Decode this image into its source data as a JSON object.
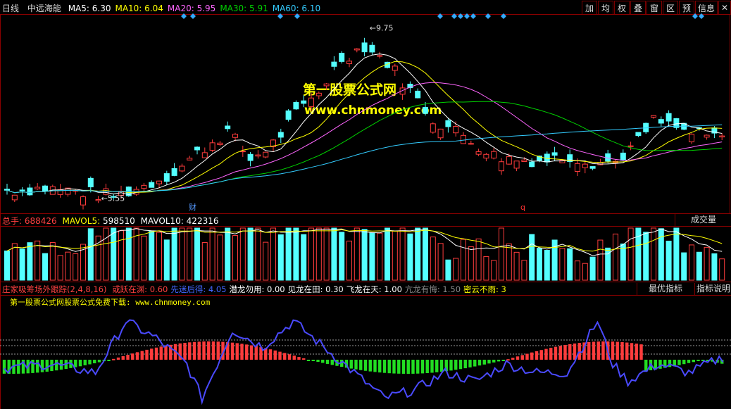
{
  "header": {
    "period": "日线",
    "stock_name": "中远海能",
    "ma": [
      {
        "label": "MA5:",
        "value": "6.30",
        "color": "#ffffff"
      },
      {
        "label": "MA10:",
        "value": "6.04",
        "color": "#ffff00"
      },
      {
        "label": "MA20:",
        "value": "5.95",
        "color": "#ff66ff"
      },
      {
        "label": "MA30:",
        "value": "5.91",
        "color": "#00d000"
      },
      {
        "label": "MA60:",
        "value": "6.10",
        "color": "#33ccff"
      }
    ]
  },
  "toolbar": [
    "加",
    "均",
    "权",
    "叠",
    "窗",
    "区",
    "预",
    "信息"
  ],
  "toolbar_close": "✕",
  "watermark": {
    "line1": "第一股票公式网",
    "line2": "www.chnmoney.com"
  },
  "price_markers": {
    "high": "9.75",
    "low": "5.55",
    "cai": "财",
    "q": "q"
  },
  "volume": {
    "total_label": "总手:",
    "total_value": "688426",
    "mavol5_label": "MAVOL5:",
    "mavol5_value": "598510",
    "mavol10_label": "MAVOL10:",
    "mavol10_value": "422316",
    "panel_button": "成交量"
  },
  "indicator": {
    "name": "庄家吸筹场外跟踪(2,4,8,16)",
    "items": [
      {
        "label": "或跃在渊:",
        "value": "0.60"
      },
      {
        "label": "先迷后得:",
        "value": "4.05"
      },
      {
        "label": "潜龙勿用:",
        "value": "0.00"
      },
      {
        "label": "见龙在田:",
        "value": "0.30"
      },
      {
        "label": "飞龙在天:",
        "value": "1.00"
      },
      {
        "label": "亢龙有悔:",
        "value": "1.50"
      },
      {
        "label": "密云不雨:",
        "value": "3"
      }
    ],
    "subtitle": "第一股票公式网股票公式免费下载: www.chnmoney.com",
    "btn_best": "最优指标",
    "btn_help": "指标说明"
  },
  "chart_data": [
    {
      "type": "candlestick",
      "title": "中远海能 日线",
      "ylim": [
        5.3,
        10.0
      ],
      "annotations": [
        {
          "text": "9.75",
          "type": "high"
        },
        {
          "text": "5.55",
          "type": "low"
        }
      ],
      "n": 95,
      "close_path": [
        [
          0,
          5.75
        ],
        [
          5,
          5.8
        ],
        [
          10,
          5.7
        ],
        [
          14,
          5.6
        ],
        [
          18,
          5.85
        ],
        [
          22,
          6.2
        ],
        [
          26,
          6.8
        ],
        [
          29,
          7.2
        ],
        [
          32,
          6.5
        ],
        [
          35,
          6.9
        ],
        [
          38,
          7.6
        ],
        [
          41,
          8.2
        ],
        [
          44,
          9.0
        ],
        [
          47,
          9.3
        ],
        [
          50,
          8.9
        ],
        [
          53,
          8.2
        ],
        [
          56,
          7.5
        ],
        [
          60,
          7.1
        ],
        [
          64,
          6.6
        ],
        [
          67,
          6.5
        ],
        [
          71,
          6.5
        ],
        [
          74,
          6.6
        ],
        [
          77,
          6.45
        ],
        [
          80,
          6.45
        ],
        [
          83,
          6.95
        ],
        [
          85,
          7.45
        ],
        [
          87,
          7.35
        ],
        [
          89,
          7.2
        ],
        [
          92,
          7.05
        ],
        [
          95,
          7.1
        ]
      ],
      "series": [
        {
          "name": "MA5",
          "value": "6.30",
          "color": "#ffffff"
        },
        {
          "name": "MA10",
          "value": "6.04",
          "color": "#ffff00"
        },
        {
          "name": "MA20",
          "value": "5.95",
          "color": "#ff66ff"
        },
        {
          "name": "MA30",
          "value": "5.91",
          "color": "#00d000"
        },
        {
          "name": "MA60",
          "value": "6.10",
          "color": "#33ccff"
        }
      ]
    },
    {
      "type": "bar",
      "title": "成交量",
      "series": [
        {
          "name": "总手",
          "value": 688426
        },
        {
          "name": "MAVOL5",
          "value": 598510
        },
        {
          "name": "MAVOL10",
          "value": 422316
        }
      ]
    },
    {
      "type": "bar",
      "title": "庄家吸筹场外跟踪(2,4,8,16)",
      "ylim": [
        -6,
        6
      ],
      "line_path": [
        [
          0,
          -1.5
        ],
        [
          6,
          -1
        ],
        [
          12,
          -2
        ],
        [
          16,
          4
        ],
        [
          20,
          2
        ],
        [
          24,
          -1
        ],
        [
          26,
          -5
        ],
        [
          30,
          3
        ],
        [
          34,
          1
        ],
        [
          38,
          4
        ],
        [
          42,
          1
        ],
        [
          46,
          -2
        ],
        [
          50,
          -5
        ],
        [
          54,
          -4
        ],
        [
          58,
          -2
        ],
        [
          62,
          -3
        ],
        [
          66,
          -1
        ],
        [
          70,
          -2
        ],
        [
          74,
          -2
        ],
        [
          78,
          4
        ],
        [
          80,
          -1
        ],
        [
          82,
          -3
        ],
        [
          86,
          -1
        ],
        [
          90,
          -2
        ],
        [
          95,
          0
        ]
      ]
    }
  ]
}
